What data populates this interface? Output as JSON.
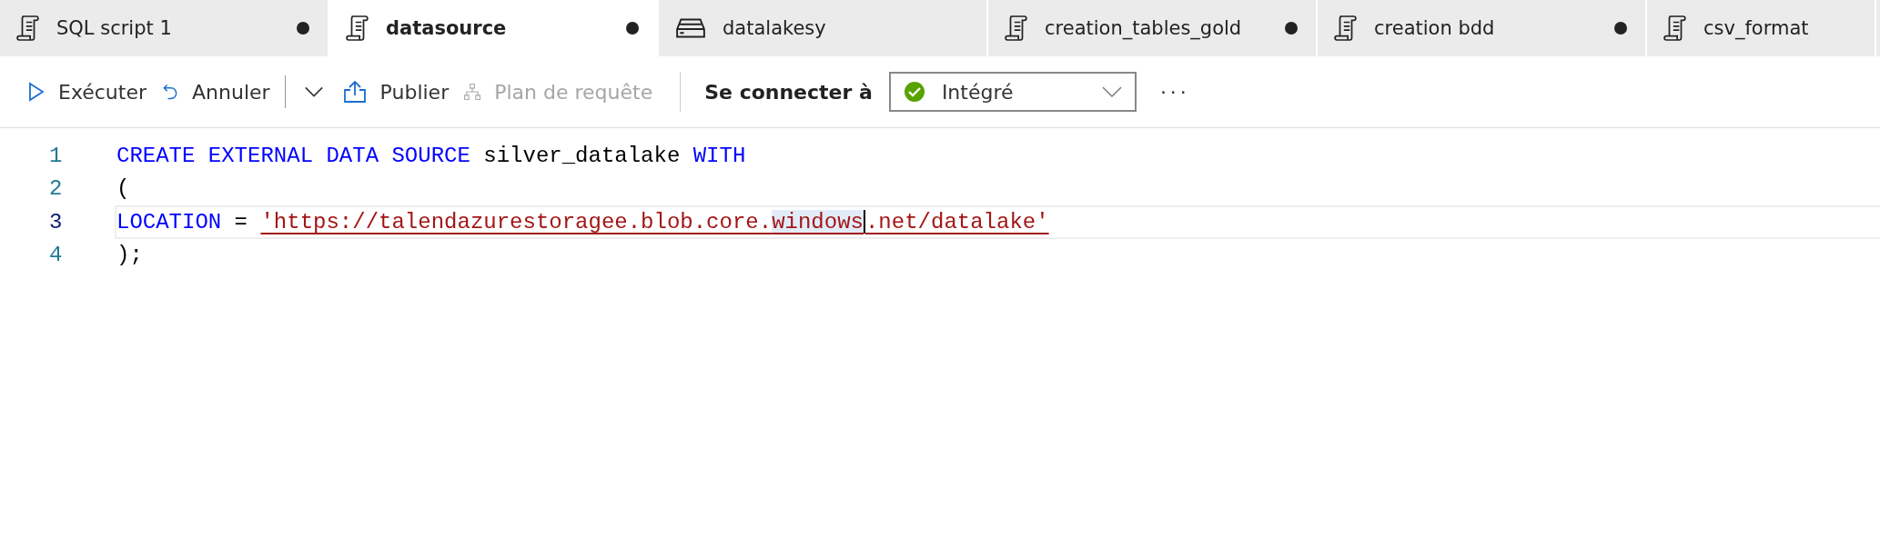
{
  "tabs": [
    {
      "label": "SQL script 1",
      "kind": "script",
      "selected": false,
      "modified": true
    },
    {
      "label": "datasource",
      "kind": "script",
      "selected": true,
      "modified": true
    },
    {
      "label": "datalakesy",
      "kind": "database",
      "selected": false,
      "modified": false
    },
    {
      "label": "creation_tables_gold",
      "kind": "script",
      "selected": false,
      "modified": true
    },
    {
      "label": "creation bdd",
      "kind": "script",
      "selected": false,
      "modified": true
    },
    {
      "label": "csv_format",
      "kind": "script",
      "selected": false,
      "modified": false
    }
  ],
  "toolbar": {
    "run": "Exécuter",
    "undo": "Annuler",
    "publish": "Publier",
    "query_plan": {
      "label": "Plan de requête",
      "disabled": true
    },
    "connect_label": "Se connecter à",
    "connection": "Intégré",
    "more": "···"
  },
  "editor": {
    "lines": [
      {
        "number": "1",
        "active": false,
        "tokens": [
          {
            "kind": "keyword",
            "text": "CREATE EXTERNAL DATA SOURCE"
          },
          {
            "kind": "plain",
            "text": " silver_datalake "
          },
          {
            "kind": "keyword",
            "text": "WITH"
          }
        ]
      },
      {
        "number": "2",
        "active": false,
        "tokens": [
          {
            "kind": "plain",
            "text": "("
          }
        ]
      },
      {
        "number": "3",
        "active": true,
        "tokens": [
          {
            "kind": "keyword",
            "text": "LOCATION"
          },
          {
            "kind": "plain",
            "text": " = "
          },
          {
            "kind": "string",
            "text": "'https://talendazurestoragee.blob.core."
          },
          {
            "kind": "string",
            "text": "windows",
            "highlighted": true,
            "cursor_after": true
          },
          {
            "kind": "string",
            "text": ".net/datalake'"
          }
        ]
      },
      {
        "number": "4",
        "active": false,
        "tokens": [
          {
            "kind": "plain",
            "text": ");"
          }
        ]
      }
    ]
  }
}
